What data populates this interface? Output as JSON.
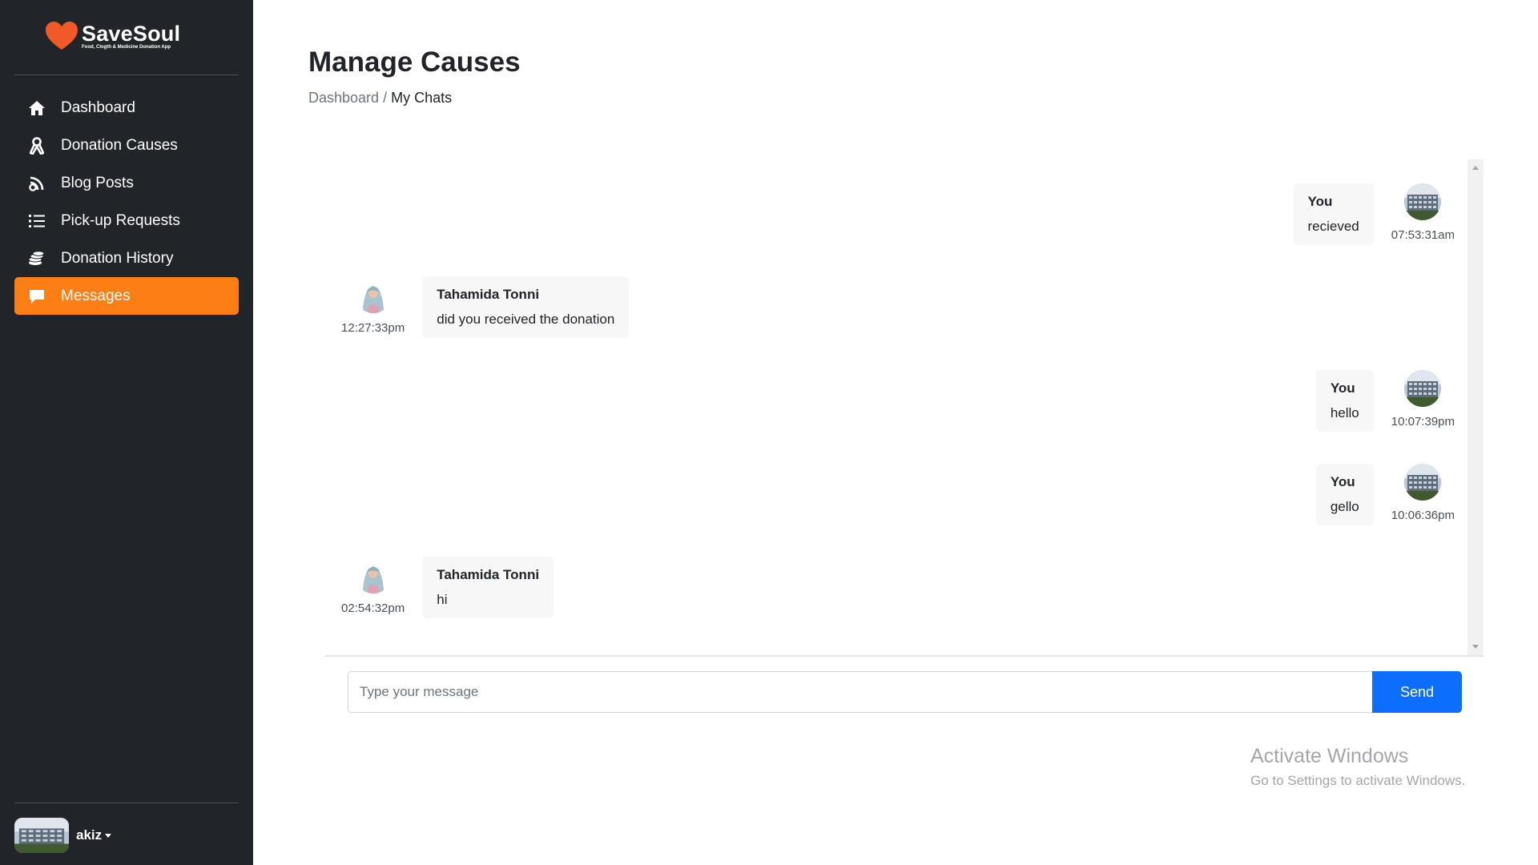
{
  "brand": {
    "name": "SaveSoul",
    "tagline": "Food, Clogth & Medicine Donation App",
    "accent": "#fd7e14"
  },
  "sidebar": {
    "items": [
      {
        "label": "Dashboard",
        "icon": "home-icon",
        "active": false
      },
      {
        "label": "Donation Causes",
        "icon": "ribbon-icon",
        "active": false
      },
      {
        "label": "Blog Posts",
        "icon": "blog-icon",
        "active": false
      },
      {
        "label": "Pick-up Requests",
        "icon": "list-icon",
        "active": false
      },
      {
        "label": "Donation History",
        "icon": "coins-icon",
        "active": false
      },
      {
        "label": "Messages",
        "icon": "chat-icon",
        "active": true
      }
    ],
    "user": {
      "name": "akiz"
    }
  },
  "header": {
    "title": "Manage Causes",
    "breadcrumb": {
      "root": "Dashboard",
      "separator": "/",
      "current": "My Chats"
    }
  },
  "chat": {
    "messages": [
      {
        "from": "You",
        "text": "recieved",
        "time": "07:53:31am",
        "side": "right"
      },
      {
        "from": "Tahamida Tonni",
        "text": "did you received the donation",
        "time": "12:27:33pm",
        "side": "left"
      },
      {
        "from": "You",
        "text": "hello",
        "time": "10:07:39pm",
        "side": "right"
      },
      {
        "from": "You",
        "text": "gello",
        "time": "10:06:36pm",
        "side": "right"
      },
      {
        "from": "Tahamida Tonni",
        "text": "hi",
        "time": "02:54:32pm",
        "side": "left"
      }
    ]
  },
  "composer": {
    "placeholder": "Type your message",
    "value": "",
    "send_label": "Send",
    "send_color": "#0d6efd"
  },
  "watermark": {
    "title": "Activate Windows",
    "subtitle": "Go to Settings to activate Windows."
  }
}
